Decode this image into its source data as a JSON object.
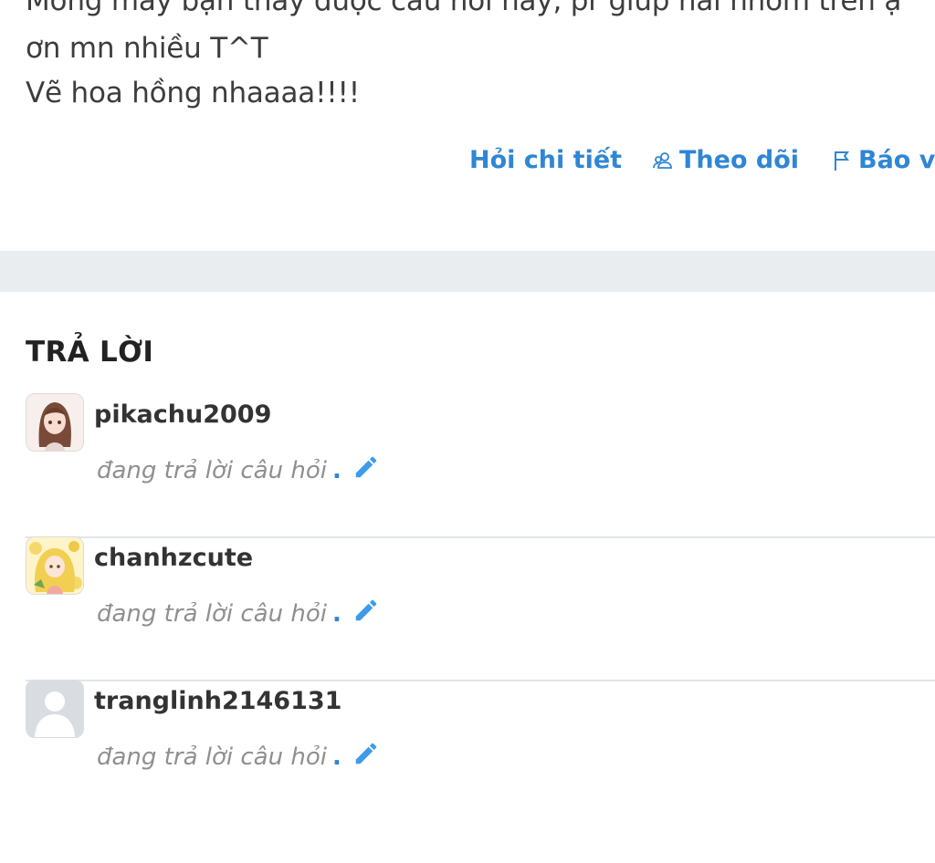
{
  "question": {
    "lines": [
      "Mong mấy bạn thấy được câu hỏi này, pr giúp hai nhóm trên ạ",
      "ơn mn nhiều T^T",
      "Vẽ hoa hồng nhaaaa!!!!"
    ],
    "actions": {
      "ask_detail": "Hỏi chi tiết",
      "follow": "Theo dõi",
      "report": "Báo vi"
    }
  },
  "answers": {
    "title": "TRẢ LỜI",
    "items": [
      {
        "username": "pikachu2009",
        "status": "đang trả lời câu hỏi",
        "dot": ".",
        "avatar_icon": "girl-avatar-icon"
      },
      {
        "username": "chanhzcute",
        "status": "đang trả lời câu hỏi",
        "dot": ".",
        "avatar_icon": "anime-avatar-icon"
      },
      {
        "username": "tranglinh2146131",
        "status": "đang trả lời câu hỏi",
        "dot": ".",
        "avatar_icon": "default-avatar-icon"
      }
    ]
  },
  "colors": {
    "accent": "#2f86d4",
    "divider_band": "#e9edf0",
    "muted_text": "#8f8f8f"
  }
}
